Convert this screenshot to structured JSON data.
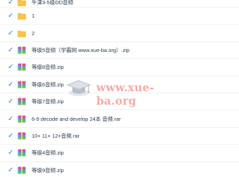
{
  "files": [
    {
      "name": "牛津3-5级DD音频",
      "type": "folder-icon",
      "selected": true
    },
    {
      "name": "1",
      "type": "folder-icon",
      "selected": true
    },
    {
      "name": "2",
      "type": "folder-icon",
      "selected": true
    },
    {
      "name": "等级5音频（学霸网 www.xue-ba.org）.zip",
      "type": "archive-icon",
      "selected": true
    },
    {
      "name": "等级8音频.zip",
      "type": "archive-icon",
      "selected": true
    },
    {
      "name": "等级6音频.zip",
      "type": "archive-icon",
      "selected": true
    },
    {
      "name": "等级7音频.zip",
      "type": "archive-icon",
      "selected": true
    },
    {
      "name": "6-9 decode and develop 24本 音频.rar",
      "type": "archive-icon",
      "selected": true
    },
    {
      "name": "10+ 11+ 12+音频.rar",
      "type": "archive-icon",
      "selected": true
    },
    {
      "name": "等级4音频.zip",
      "type": "archive-icon",
      "selected": true
    },
    {
      "name": "等级9音频.zip",
      "type": "archive-icon",
      "selected": true
    }
  ],
  "watermark": {
    "text": "www.xue-ba.org",
    "icon": "graduation-cap-icon"
  },
  "colors": {
    "checkbox": "#2b7de9",
    "folder": "#f7c548",
    "watermark": "#f3a39e"
  }
}
